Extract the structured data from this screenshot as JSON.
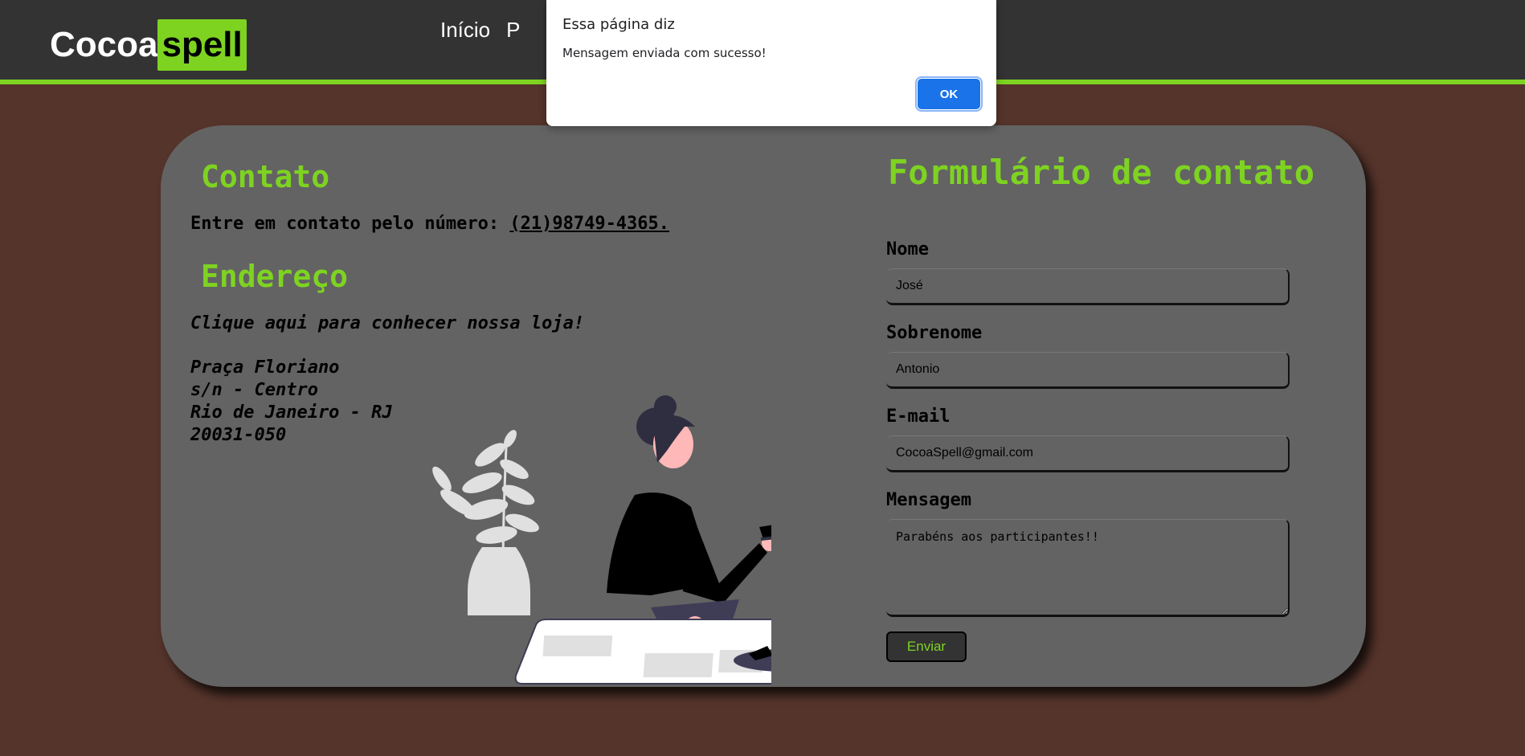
{
  "header": {
    "logo_part1": "Cocoa",
    "logo_part2": "spell",
    "nav": [
      {
        "label": "Início"
      },
      {
        "label": "P"
      }
    ]
  },
  "contact": {
    "title": "Contato",
    "phone_prefix": "Entre em contato pelo número: ",
    "phone_link": "(21)98749-4365."
  },
  "address": {
    "title": "Endereço",
    "store_link": "Clique aqui para conhecer nossa loja!",
    "lines": [
      "Praça Floriano",
      "s/n - Centro",
      "Rio de Janeiro - RJ",
      "20031-050"
    ]
  },
  "form": {
    "title": "Formulário de contato",
    "fields": [
      {
        "label": "Nome",
        "value": "José"
      },
      {
        "label": "Sobrenome",
        "value": "Antonio"
      },
      {
        "label": "E-mail",
        "value": "CocoaSpell@gmail.com"
      }
    ],
    "message_label": "Mensagem",
    "message_value": "Parabéns aos participantes!!",
    "submit_label": "Enviar"
  },
  "alert": {
    "title": "Essa página diz",
    "message": "Mensagem enviada com sucesso!",
    "ok_label": "OK"
  },
  "colors": {
    "accent": "#7ed321",
    "page_bg": "#55342b",
    "header_bg": "#333333",
    "card_bg": "#636363",
    "dialog_button": "#1a73e8"
  }
}
